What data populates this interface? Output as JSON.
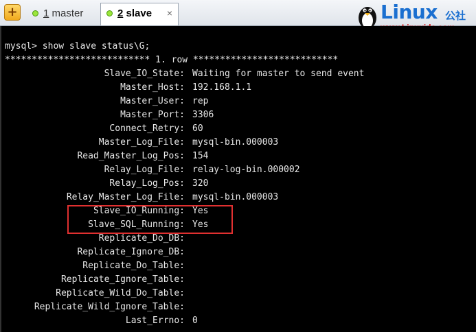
{
  "tabs": [
    {
      "number": "1",
      "label": "master"
    },
    {
      "number": "2",
      "label": "slave",
      "active": true
    }
  ],
  "tab_close": "×",
  "add_tab": "+",
  "logo": {
    "text": "Linux",
    "cn": "公社",
    "url": "www.Linuxidc.com"
  },
  "terminal": {
    "prompt_line": "mysql> show slave status\\G;",
    "row_header": "*************************** 1. row ***************************",
    "fields": [
      {
        "name": "Slave_IO_State:",
        "value": "Waiting for master to send event"
      },
      {
        "name": "Master_Host:",
        "value": "192.168.1.1"
      },
      {
        "name": "Master_User:",
        "value": "rep"
      },
      {
        "name": "Master_Port:",
        "value": "3306"
      },
      {
        "name": "Connect_Retry:",
        "value": "60"
      },
      {
        "name": "Master_Log_File:",
        "value": "mysql-bin.000003"
      },
      {
        "name": "Read_Master_Log_Pos:",
        "value": "154"
      },
      {
        "name": "Relay_Log_File:",
        "value": "relay-log-bin.000002"
      },
      {
        "name": "Relay_Log_Pos:",
        "value": "320"
      },
      {
        "name": "Relay_Master_Log_File:",
        "value": "mysql-bin.000003"
      },
      {
        "name": "Slave_IO_Running:",
        "value": "Yes"
      },
      {
        "name": "Slave_SQL_Running:",
        "value": "Yes"
      },
      {
        "name": "Replicate_Do_DB:",
        "value": ""
      },
      {
        "name": "Replicate_Ignore_DB:",
        "value": ""
      },
      {
        "name": "Replicate_Do_Table:",
        "value": ""
      },
      {
        "name": "Replicate_Ignore_Table:",
        "value": ""
      },
      {
        "name": "Replicate_Wild_Do_Table:",
        "value": ""
      },
      {
        "name": "Replicate_Wild_Ignore_Table:",
        "value": ""
      },
      {
        "name": "Last_Errno:",
        "value": "0"
      }
    ]
  },
  "colors": {
    "terminal_bg": "#000000",
    "terminal_fg": "#e8e8e8",
    "highlight": "#e03030",
    "logo_blue": "#1a6fd0",
    "logo_red": "#d01010"
  }
}
